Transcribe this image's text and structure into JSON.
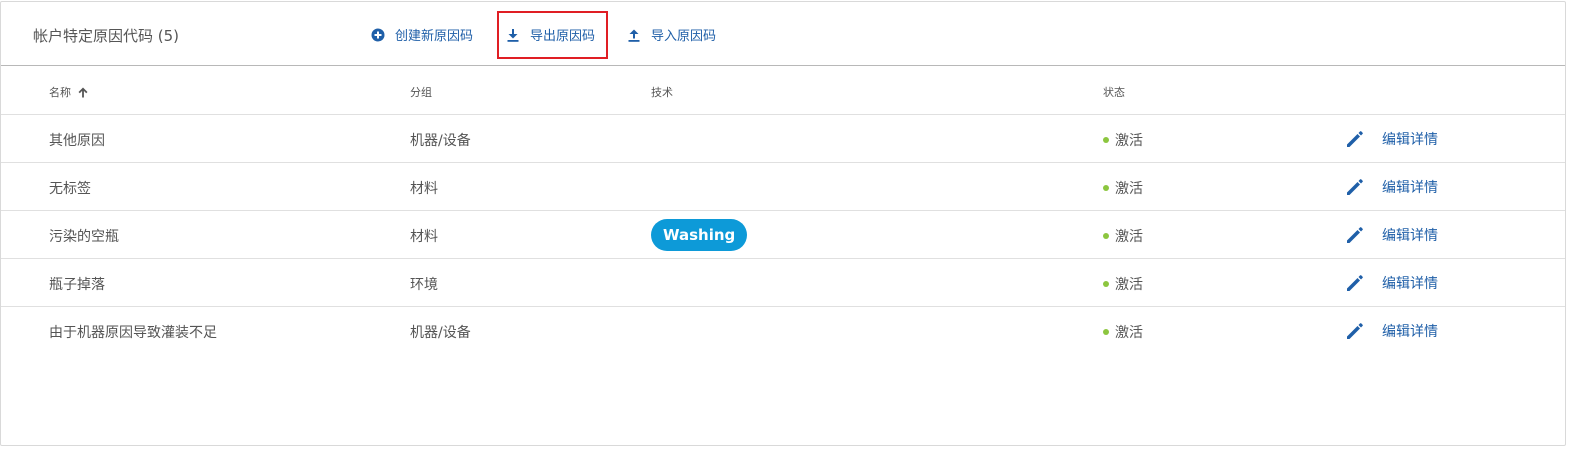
{
  "header": {
    "title": "帐户特定原因代码 (5)",
    "actions": [
      {
        "label": "创建新原因码",
        "icon": "plus-circle-icon"
      },
      {
        "label": "导出原因码",
        "icon": "download-icon"
      },
      {
        "label": "导入原因码",
        "icon": "upload-icon"
      }
    ]
  },
  "table": {
    "columns": [
      "名称",
      "分组",
      "技术",
      "状态"
    ],
    "sort": {
      "column": "名称",
      "direction": "ascending",
      "icon": "arrow-up-icon"
    },
    "edit_label": "编辑详情",
    "rows": [
      {
        "name": "其他原因",
        "group": "机器/设备",
        "tech": "",
        "status": "激活"
      },
      {
        "name": "无标签",
        "group": "材料",
        "tech": "",
        "status": "激活"
      },
      {
        "name": "污染的空瓶",
        "group": "材料",
        "tech": "Washing",
        "status": "激活"
      },
      {
        "name": "瓶子掉落",
        "group": "环境",
        "tech": "",
        "status": "激活"
      },
      {
        "name": "由于机器原因导致灌装不足",
        "group": "机器/设备",
        "tech": "",
        "status": "激活"
      }
    ]
  },
  "colors": {
    "link": "#1f5fa8",
    "active_dot": "#8cc63f",
    "badge": "#0d9ad8",
    "highlight": "#e01e24"
  }
}
